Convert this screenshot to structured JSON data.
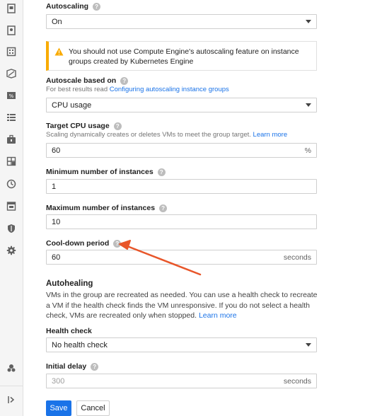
{
  "sidebar": {
    "icons": [
      "instance-icon",
      "instance-template-icon",
      "instance-group-icon",
      "disk-icon",
      "snapshot-icon",
      "image-icon",
      "toolbox-icon",
      "grid-icon",
      "clock-icon",
      "calendar-icon",
      "shield-icon",
      "gear-icon"
    ],
    "bottom_icons": [
      "marketplace-icon",
      "expand-icon"
    ]
  },
  "autoscaling": {
    "label": "Autoscaling",
    "value": "On"
  },
  "warning": {
    "text": "You should not use Compute Engine's autoscaling feature on instance groups created by Kubernetes Engine"
  },
  "autoscale_based_on": {
    "label": "Autoscale based on",
    "hint_prefix": "For best results read ",
    "hint_link": "Configuring autoscaling instance groups",
    "value": "CPU usage"
  },
  "target_cpu": {
    "label": "Target CPU usage",
    "hint_prefix": "Scaling dynamically creates or deletes VMs to meet the group target. ",
    "hint_link": "Learn more",
    "value": "60",
    "suffix": "%"
  },
  "min_instances": {
    "label": "Minimum number of instances",
    "value": "1"
  },
  "max_instances": {
    "label": "Maximum number of instances",
    "value": "10"
  },
  "cooldown": {
    "label": "Cool-down period",
    "value": "60",
    "suffix": "seconds"
  },
  "autohealing": {
    "title": "Autohealing",
    "description": "VMs in the group are recreated as needed. You can use a health check to recreate a VM if the health check finds the VM unresponsive. If you do not select a health check, VMs are recreated only when stopped. ",
    "link": "Learn more"
  },
  "health_check": {
    "label": "Health check",
    "value": "No health check"
  },
  "initial_delay": {
    "label": "Initial delay",
    "placeholder": "300",
    "suffix": "seconds"
  },
  "buttons": {
    "save": "Save",
    "cancel": "Cancel"
  },
  "help_glyph": "?",
  "colors": {
    "accent": "#1a73e8",
    "warning": "#f9ab00",
    "annotation_arrow": "#e8562a"
  }
}
